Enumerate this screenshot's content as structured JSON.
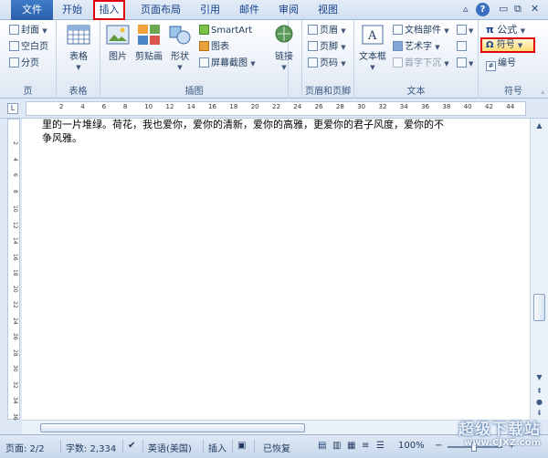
{
  "tabs": [
    "文件",
    "开始",
    "插入",
    "页面布局",
    "引用",
    "邮件",
    "审阅",
    "视图"
  ],
  "window": {
    "help": "?",
    "minimize": "▭",
    "restore": "⧉",
    "close": "✕",
    "collapse_ribbon": "▵"
  },
  "ribbon": {
    "page": {
      "cover": "封面",
      "blank": "空白页",
      "break": "分页",
      "label": "页"
    },
    "table": {
      "table": "表格",
      "label": "表格"
    },
    "illustrations": {
      "picture": "图片",
      "clipart": "剪贴画",
      "shapes": "形状",
      "smartart": "SmartArt",
      "chart": "图表",
      "screenshot": "屏幕截图",
      "label": "插图"
    },
    "links": {
      "link": "链接"
    },
    "header_footer": {
      "header": "页眉",
      "footer": "页脚",
      "page_number": "页码",
      "label": "页眉和页脚"
    },
    "text": {
      "textbox": "文本框",
      "quickparts": "文档部件",
      "wordart": "艺术字",
      "dropcap": "首字下沉",
      "label": "文本"
    },
    "symbols": {
      "equation": "公式",
      "symbol": "符号",
      "number": "编号",
      "label": "符号"
    }
  },
  "ruler": {
    "tab_selector": "L",
    "ticks": [
      "2",
      "4",
      "6",
      "8",
      "10",
      "12",
      "14",
      "16",
      "18",
      "20",
      "22",
      "24",
      "26",
      "28",
      "30",
      "32",
      "34",
      "36",
      "38",
      "40",
      "42",
      "44"
    ],
    "vticks": [
      "2",
      "4",
      "6",
      "8",
      "10",
      "12",
      "14",
      "16",
      "18",
      "20",
      "22",
      "24",
      "26",
      "28",
      "30",
      "32",
      "34",
      "36"
    ]
  },
  "document": {
    "line1": "里的一片堆绿。荷花，我也爱你，爱你的清新，爱你的高雅，更爱你的君子风度，爱你的不",
    "line2": "争风雅。"
  },
  "status": {
    "page": "页面: 2/2",
    "words": "字数: 2,334",
    "language": "英语(美国)",
    "mode": "插入",
    "recovered": "已恢复",
    "zoom": "100%",
    "zoom_minus": "−",
    "zoom_plus": "+"
  },
  "watermark": {
    "title": "超级下载站",
    "url": "www.CJXZ.com"
  },
  "colors": {
    "accent_red": "#e0000e",
    "file_tab": "#2a5ea9",
    "ribbon_text": "#1e395b"
  }
}
